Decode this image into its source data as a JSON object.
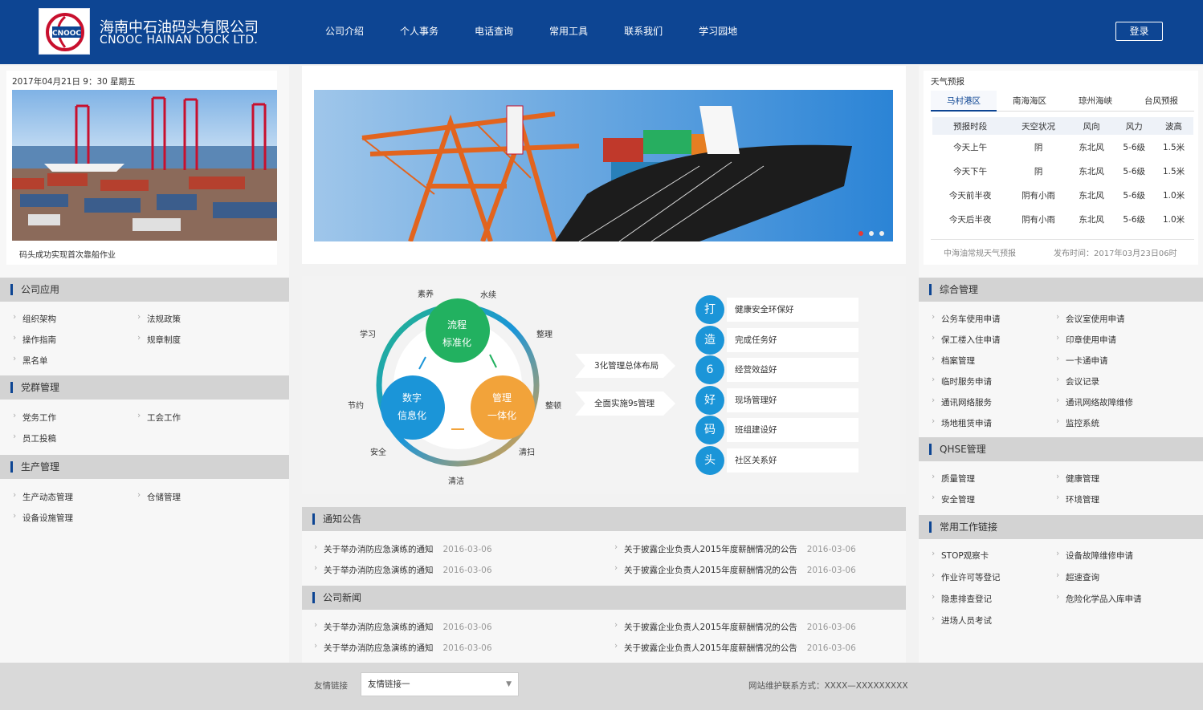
{
  "brand": {
    "cn": "海南中石油码头有限公司",
    "en": "CNOOC HAINAN DOCK LTD.",
    "logo_text": "CNOOC"
  },
  "nav": [
    "公司介绍",
    "个人事务",
    "电话查询",
    "常用工具",
    "联系我们",
    "学习园地"
  ],
  "login": "登录",
  "datetime": "2017年04月21日  9：30   星期五",
  "photo_caption": "码头成功实现首次靠船作业",
  "left_sections": [
    {
      "title": "公司应用",
      "items": [
        "组织架构",
        "法规政策",
        "操作指南",
        "规章制度",
        "黑名单"
      ]
    },
    {
      "title": "党群管理",
      "items": [
        "党务工作",
        "工会工作",
        "员工投稿"
      ]
    },
    {
      "title": "生产管理",
      "items": [
        "生产动态管理",
        "仓储管理",
        "设备设施管理"
      ]
    }
  ],
  "diagram": {
    "nodes": [
      {
        "l1": "流程",
        "l2": "标准化"
      },
      {
        "l1": "数字",
        "l2": "信息化"
      },
      {
        "l1": "管理",
        "l2": "一体化"
      }
    ],
    "ring_labels": [
      "素养",
      "水续",
      "整理",
      "整顿",
      "清扫",
      "清洁",
      "安全",
      "节约",
      "学习"
    ],
    "arrows": [
      "3化管理总体布局",
      "全面实施9s管理"
    ],
    "services": [
      {
        "char": "打",
        "text": "健康安全环保好"
      },
      {
        "char": "造",
        "text": "完成任务好"
      },
      {
        "char": "6",
        "text": "经营效益好"
      },
      {
        "char": "好",
        "text": "现场管理好"
      },
      {
        "char": "码",
        "text": "班组建设好"
      },
      {
        "char": "头",
        "text": "社区关系好"
      }
    ]
  },
  "notices": {
    "title": "通知公告",
    "rows": [
      {
        "left": "关于举办消防应急演练的通知",
        "ldate": "2016-03-06",
        "right": "关于披露企业负责人2015年度薪酬情况的公告",
        "rdate": "2016-03-06"
      },
      {
        "left": "关于举办消防应急演练的通知",
        "ldate": "2016-03-06",
        "right": "关于披露企业负责人2015年度薪酬情况的公告",
        "rdate": "2016-03-06"
      }
    ]
  },
  "news": {
    "title": "公司新闻",
    "rows": [
      {
        "left": "关于举办消防应急演练的通知",
        "ldate": "2016-03-06",
        "right": "关于披露企业负责人2015年度薪酬情况的公告",
        "rdate": "2016-03-06"
      },
      {
        "left": "关于举办消防应急演练的通知",
        "ldate": "2016-03-06",
        "right": "关于披露企业负责人2015年度薪酬情况的公告",
        "rdate": "2016-03-06"
      }
    ]
  },
  "weather": {
    "title": "天气预报",
    "tabs": [
      "马村港区",
      "南海海区",
      "琼州海峡",
      "台风预报"
    ],
    "headers": [
      "预报时段",
      "天空状况",
      "风向",
      "风力",
      "波高"
    ],
    "rows": [
      [
        "今天上午",
        "阴",
        "东北风",
        "5-6级",
        "1.5米"
      ],
      [
        "今天下午",
        "阴",
        "东北风",
        "5-6级",
        "1.5米"
      ],
      [
        "今天前半夜",
        "阴有小雨",
        "东北风",
        "5-6级",
        "1.0米"
      ],
      [
        "今天后半夜",
        "阴有小雨",
        "东北风",
        "5-6级",
        "1.0米"
      ]
    ],
    "source": "中海油常规天气预报",
    "published": "发布时间：2017年03月23日06时"
  },
  "right_sections": [
    {
      "title": "综合管理",
      "items": [
        "公务车使用申请",
        "会议室使用申请",
        "保工楼入住申请",
        "印章使用申请",
        "档案管理",
        "一卡通申请",
        "临时服务申请",
        "会议记录",
        "通讯网络服务",
        "通讯网络故障维修",
        "场地租赁申请",
        "监控系统"
      ]
    },
    {
      "title": "QHSE管理",
      "items": [
        "质量管理",
        "健康管理",
        "安全管理",
        "环境管理"
      ]
    },
    {
      "title": "常用工作链接",
      "items": [
        "STOP观察卡",
        "设备故障维修申请",
        "作业许可等登记",
        "超速查询",
        "隐患排查登记",
        "危险化学品入库申请",
        "进场人员考试"
      ]
    }
  ],
  "footer": {
    "links_label": "友情链接",
    "select_value": "友情链接一",
    "contact": "网站维护联系方式：XXXX—XXXXXXXXX"
  },
  "colors": {
    "primary": "#0d4593",
    "accent": "#1b95d8"
  }
}
